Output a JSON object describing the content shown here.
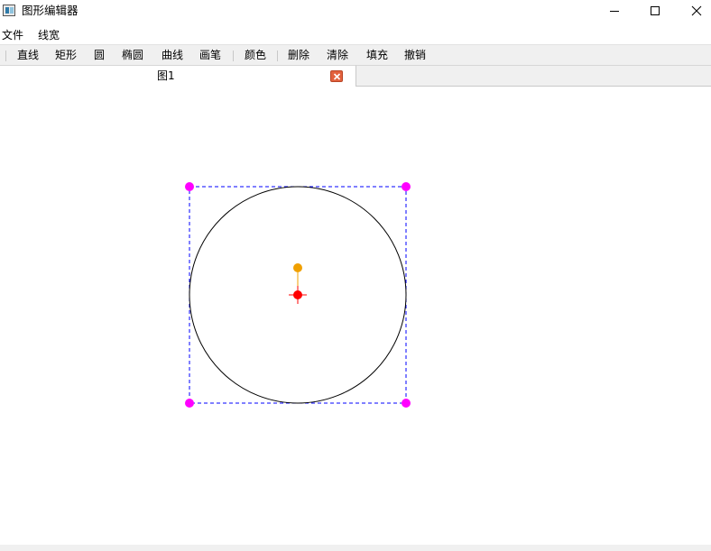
{
  "window": {
    "title": "图形编辑器",
    "controls": [
      "minimize-icon",
      "maximize-icon",
      "close-icon"
    ]
  },
  "menubar": {
    "file": "文件",
    "line_width": "线宽"
  },
  "toolbar": {
    "line": "直线",
    "rect": "矩形",
    "circle": "圆",
    "ellipse": "椭圆",
    "curve": "曲线",
    "pen": "画笔",
    "color": "颜色",
    "delete": "删除",
    "clear": "清除",
    "fill": "填充",
    "undo": "撤销"
  },
  "tabs": [
    {
      "label": "图1",
      "active": true,
      "close_icon": "close-tab-icon"
    }
  ],
  "canvas": {
    "shapes": [
      {
        "type": "circle",
        "selected": true,
        "stroke": "#000000",
        "bounding_box_style": "dashed",
        "bounding_box_color": "#0000ff",
        "handle_color": "#ff00ff",
        "rotate_handle_color": "#f0a000",
        "center_marker_color": "#ff0000"
      }
    ]
  },
  "colors": {
    "toolbar_bg": "#f0f0f0",
    "tab_close": "#e2613d"
  }
}
